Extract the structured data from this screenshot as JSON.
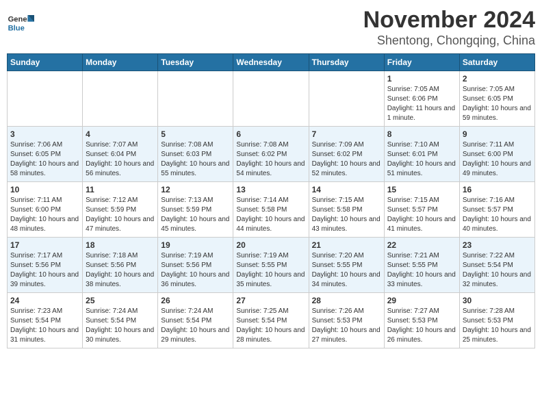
{
  "header": {
    "logo_general": "General",
    "logo_blue": "Blue",
    "month_year": "November 2024",
    "location": "Shentong, Chongqing, China"
  },
  "days_of_week": [
    "Sunday",
    "Monday",
    "Tuesday",
    "Wednesday",
    "Thursday",
    "Friday",
    "Saturday"
  ],
  "weeks": [
    [
      {
        "day": "",
        "info": ""
      },
      {
        "day": "",
        "info": ""
      },
      {
        "day": "",
        "info": ""
      },
      {
        "day": "",
        "info": ""
      },
      {
        "day": "",
        "info": ""
      },
      {
        "day": "1",
        "info": "Sunrise: 7:05 AM\nSunset: 6:06 PM\nDaylight: 11 hours and 1 minute."
      },
      {
        "day": "2",
        "info": "Sunrise: 7:05 AM\nSunset: 6:05 PM\nDaylight: 10 hours and 59 minutes."
      }
    ],
    [
      {
        "day": "3",
        "info": "Sunrise: 7:06 AM\nSunset: 6:05 PM\nDaylight: 10 hours and 58 minutes."
      },
      {
        "day": "4",
        "info": "Sunrise: 7:07 AM\nSunset: 6:04 PM\nDaylight: 10 hours and 56 minutes."
      },
      {
        "day": "5",
        "info": "Sunrise: 7:08 AM\nSunset: 6:03 PM\nDaylight: 10 hours and 55 minutes."
      },
      {
        "day": "6",
        "info": "Sunrise: 7:08 AM\nSunset: 6:02 PM\nDaylight: 10 hours and 54 minutes."
      },
      {
        "day": "7",
        "info": "Sunrise: 7:09 AM\nSunset: 6:02 PM\nDaylight: 10 hours and 52 minutes."
      },
      {
        "day": "8",
        "info": "Sunrise: 7:10 AM\nSunset: 6:01 PM\nDaylight: 10 hours and 51 minutes."
      },
      {
        "day": "9",
        "info": "Sunrise: 7:11 AM\nSunset: 6:00 PM\nDaylight: 10 hours and 49 minutes."
      }
    ],
    [
      {
        "day": "10",
        "info": "Sunrise: 7:11 AM\nSunset: 6:00 PM\nDaylight: 10 hours and 48 minutes."
      },
      {
        "day": "11",
        "info": "Sunrise: 7:12 AM\nSunset: 5:59 PM\nDaylight: 10 hours and 47 minutes."
      },
      {
        "day": "12",
        "info": "Sunrise: 7:13 AM\nSunset: 5:59 PM\nDaylight: 10 hours and 45 minutes."
      },
      {
        "day": "13",
        "info": "Sunrise: 7:14 AM\nSunset: 5:58 PM\nDaylight: 10 hours and 44 minutes."
      },
      {
        "day": "14",
        "info": "Sunrise: 7:15 AM\nSunset: 5:58 PM\nDaylight: 10 hours and 43 minutes."
      },
      {
        "day": "15",
        "info": "Sunrise: 7:15 AM\nSunset: 5:57 PM\nDaylight: 10 hours and 41 minutes."
      },
      {
        "day": "16",
        "info": "Sunrise: 7:16 AM\nSunset: 5:57 PM\nDaylight: 10 hours and 40 minutes."
      }
    ],
    [
      {
        "day": "17",
        "info": "Sunrise: 7:17 AM\nSunset: 5:56 PM\nDaylight: 10 hours and 39 minutes."
      },
      {
        "day": "18",
        "info": "Sunrise: 7:18 AM\nSunset: 5:56 PM\nDaylight: 10 hours and 38 minutes."
      },
      {
        "day": "19",
        "info": "Sunrise: 7:19 AM\nSunset: 5:56 PM\nDaylight: 10 hours and 36 minutes."
      },
      {
        "day": "20",
        "info": "Sunrise: 7:19 AM\nSunset: 5:55 PM\nDaylight: 10 hours and 35 minutes."
      },
      {
        "day": "21",
        "info": "Sunrise: 7:20 AM\nSunset: 5:55 PM\nDaylight: 10 hours and 34 minutes."
      },
      {
        "day": "22",
        "info": "Sunrise: 7:21 AM\nSunset: 5:55 PM\nDaylight: 10 hours and 33 minutes."
      },
      {
        "day": "23",
        "info": "Sunrise: 7:22 AM\nSunset: 5:54 PM\nDaylight: 10 hours and 32 minutes."
      }
    ],
    [
      {
        "day": "24",
        "info": "Sunrise: 7:23 AM\nSunset: 5:54 PM\nDaylight: 10 hours and 31 minutes."
      },
      {
        "day": "25",
        "info": "Sunrise: 7:24 AM\nSunset: 5:54 PM\nDaylight: 10 hours and 30 minutes."
      },
      {
        "day": "26",
        "info": "Sunrise: 7:24 AM\nSunset: 5:54 PM\nDaylight: 10 hours and 29 minutes."
      },
      {
        "day": "27",
        "info": "Sunrise: 7:25 AM\nSunset: 5:54 PM\nDaylight: 10 hours and 28 minutes."
      },
      {
        "day": "28",
        "info": "Sunrise: 7:26 AM\nSunset: 5:53 PM\nDaylight: 10 hours and 27 minutes."
      },
      {
        "day": "29",
        "info": "Sunrise: 7:27 AM\nSunset: 5:53 PM\nDaylight: 10 hours and 26 minutes."
      },
      {
        "day": "30",
        "info": "Sunrise: 7:28 AM\nSunset: 5:53 PM\nDaylight: 10 hours and 25 minutes."
      }
    ]
  ]
}
